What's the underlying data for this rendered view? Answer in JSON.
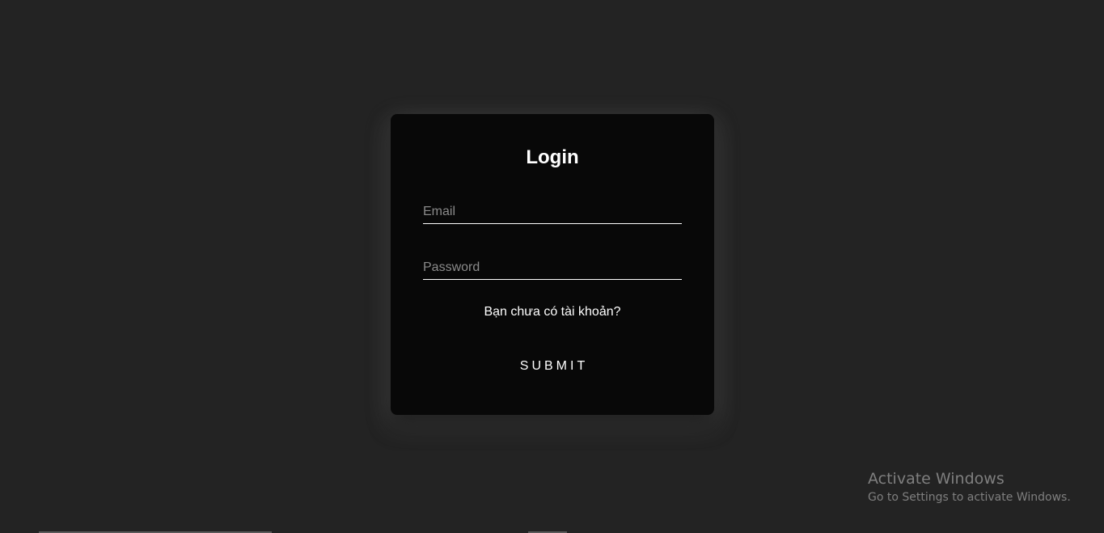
{
  "login": {
    "title": "Login",
    "email_placeholder": "Email",
    "email_value": "",
    "password_placeholder": "Password",
    "password_value": "",
    "signup_link": "Bạn chưa có tài khoản?",
    "submit_label": "SUBMIT"
  },
  "watermark": {
    "title": "Activate Windows",
    "subtitle": "Go to Settings to activate Windows."
  },
  "colors": {
    "background": "#232323",
    "card": "#080808",
    "text": "#ffffff",
    "placeholder": "#8a8a8a"
  }
}
